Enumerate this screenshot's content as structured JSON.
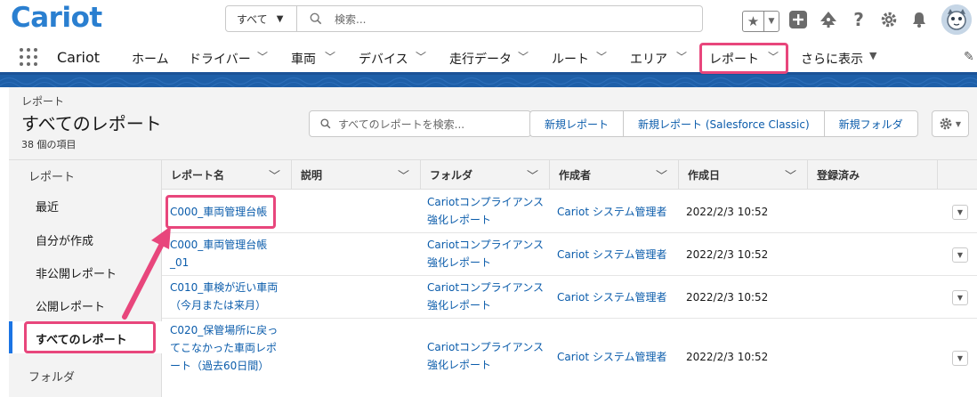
{
  "header": {
    "logo": "Cariot",
    "search_scope": "すべて",
    "search_placeholder": "検索..."
  },
  "nav": {
    "app_name": "Cariot",
    "items": [
      {
        "label": "ホーム",
        "has_menu": false
      },
      {
        "label": "ドライバー",
        "has_menu": true
      },
      {
        "label": "車両",
        "has_menu": true
      },
      {
        "label": "デバイス",
        "has_menu": true
      },
      {
        "label": "走行データ",
        "has_menu": true
      },
      {
        "label": "ルート",
        "has_menu": true
      },
      {
        "label": "エリア",
        "has_menu": true
      },
      {
        "label": "レポート",
        "has_menu": true,
        "active": true
      }
    ],
    "more": "さらに表示"
  },
  "page": {
    "object_label": "レポート",
    "title": "すべてのレポート",
    "count": "38 個の項目",
    "search_placeholder": "すべてのレポートを検索...",
    "buttons": [
      "新規レポート",
      "新規レポート (Salesforce Classic)",
      "新規フォルダ"
    ]
  },
  "sidebar": {
    "section_reports": "レポート",
    "items": [
      "最近",
      "自分が作成",
      "非公開レポート",
      "公開レポート",
      "すべてのレポート"
    ],
    "selected": "すべてのレポート",
    "section_folders": "フォルダ"
  },
  "table": {
    "columns": [
      "レポート名",
      "説明",
      "フォルダ",
      "作成者",
      "作成日",
      "登録済み"
    ],
    "rows": [
      {
        "name": "C000_車両管理台帳",
        "folder": "Cariotコンプライアンス強化レポート",
        "creator": "Cariot システム管理者",
        "created": "2022/2/3 10:52"
      },
      {
        "name": "C000_車両管理台帳_01",
        "folder": "Cariotコンプライアンス強化レポート",
        "creator": "Cariot システム管理者",
        "created": "2022/2/3 10:52"
      },
      {
        "name": "C010_車検が近い車両（今月または来月）",
        "folder": "Cariotコンプライアンス強化レポート",
        "creator": "Cariot システム管理者",
        "created": "2022/2/3 10:52"
      },
      {
        "name": "C020_保管場所に戻ってこなかった車両レポート（過去60日間）",
        "folder": "Cariotコンプライアンス強化レポート",
        "creator": "Cariot システム管理者",
        "created": "2022/2/3 10:52"
      }
    ]
  },
  "colors": {
    "brand": "#2a7fd0",
    "link": "#0b5cab",
    "highlight": "#e8467c",
    "band": "#1e5fa8"
  }
}
